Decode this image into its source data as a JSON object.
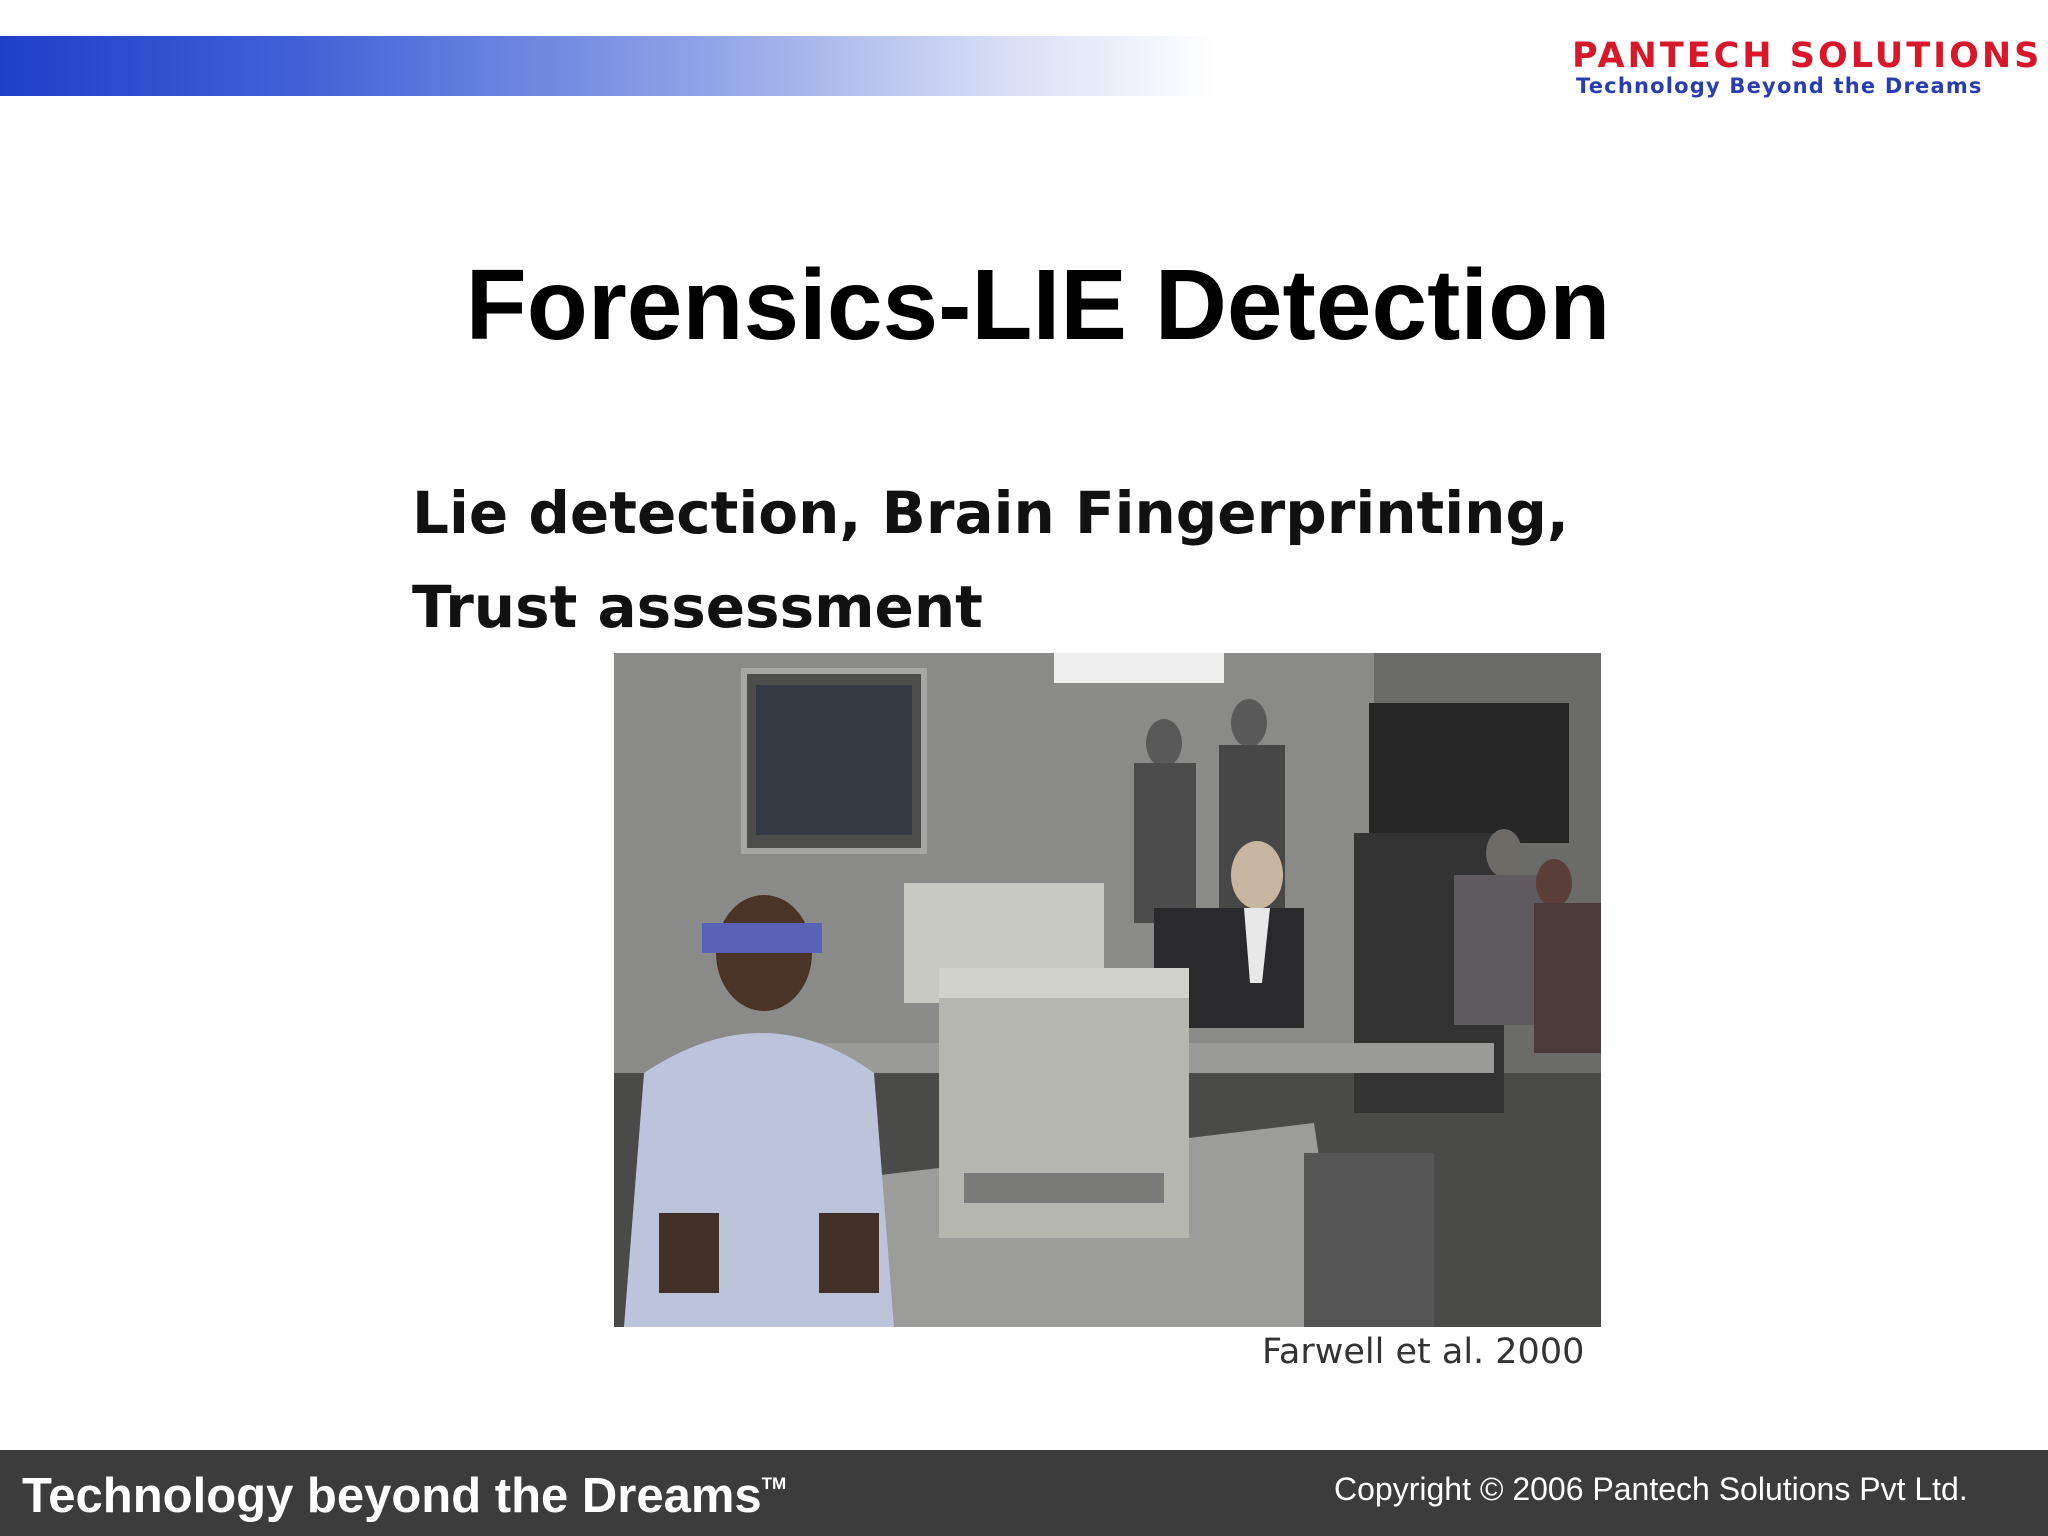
{
  "header": {
    "logo_name": "PANTECH SOLUTIONS",
    "logo_tagline": "Technology Beyond the Dreams"
  },
  "slide": {
    "title": "Forensics-LIE Detection",
    "subtitle": "Lie detection, Brain Fingerprinting, Trust assessment",
    "caption": "Farwell et al. 2000"
  },
  "footer": {
    "left_text": "Technology beyond the Dreams",
    "trademark": "TM",
    "right_text": "Copyright © 2006 Pantech Solutions Pvt Ltd."
  },
  "colors": {
    "band_start": "#1e3fc8",
    "logo_red": "#d8182a",
    "logo_blue": "#2a3db0",
    "footer_bg": "#3c3c3c"
  }
}
